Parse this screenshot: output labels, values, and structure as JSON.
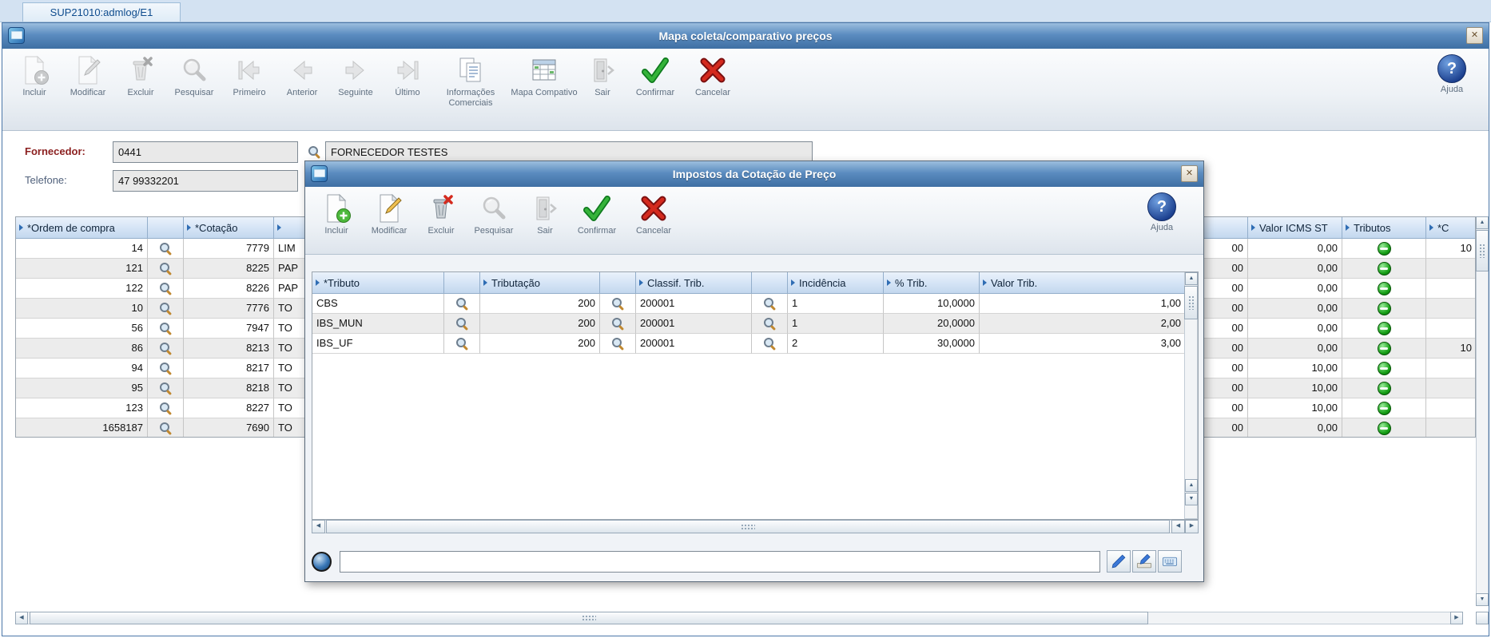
{
  "app": {
    "tab_title": "SUP21010:admlog/E1"
  },
  "colors": {
    "titlebar_blue": "#4f7fb3",
    "header_blue": "#c3d8ee",
    "confirm_green": "#35b33a",
    "cancel_red": "#d42a1e",
    "tributos_green": "#17a017",
    "label_maroon": "#8b1f1f"
  },
  "main_window": {
    "title": "Mapa coleta/comparativo preços",
    "toolbar": [
      {
        "label": "Incluir",
        "disabled": true
      },
      {
        "label": "Modificar",
        "disabled": true
      },
      {
        "label": "Excluir",
        "disabled": true
      },
      {
        "label": "Pesquisar",
        "disabled": true
      },
      {
        "label": "Primeiro",
        "disabled": true
      },
      {
        "label": "Anterior",
        "disabled": true
      },
      {
        "label": "Seguinte",
        "disabled": true
      },
      {
        "label": "Último",
        "disabled": true
      },
      {
        "label": "Informações Comerciais",
        "disabled": false
      },
      {
        "label": "Mapa Compativo",
        "disabled": false
      },
      {
        "label": "Sair",
        "disabled": true
      },
      {
        "label": "Confirmar",
        "disabled": false
      },
      {
        "label": "Cancelar",
        "disabled": false
      }
    ],
    "help_label": "Ajuda",
    "form": {
      "fornecedor_label": "Fornecedor:",
      "fornecedor_code": "0441",
      "fornecedor_name": "FORNECEDOR TESTES",
      "telefone_label": "Telefone:",
      "telefone_value": "47 99332201"
    },
    "table": {
      "col_ordem": "*Ordem de compra",
      "col_cotacao": "*Cotação",
      "col_icms_st": "Valor ICMS ST",
      "col_tributos": "Tributos",
      "col_partial": "*C",
      "rows": [
        {
          "ordem": "14",
          "cotacao": "7779",
          "desc": "LIM",
          "tail": "00",
          "icms_st": "0,00",
          "partial": "10"
        },
        {
          "ordem": "121",
          "cotacao": "8225",
          "desc": "PAP",
          "tail": "00",
          "icms_st": "0,00",
          "partial": ""
        },
        {
          "ordem": "122",
          "cotacao": "8226",
          "desc": "PAP",
          "tail": "00",
          "icms_st": "0,00",
          "partial": ""
        },
        {
          "ordem": "10",
          "cotacao": "7776",
          "desc": "TO",
          "tail": "00",
          "icms_st": "0,00",
          "partial": ""
        },
        {
          "ordem": "56",
          "cotacao": "7947",
          "desc": "TO",
          "tail": "00",
          "icms_st": "0,00",
          "partial": ""
        },
        {
          "ordem": "86",
          "cotacao": "8213",
          "desc": "TO",
          "tail": "00",
          "icms_st": "0,00",
          "partial": "10"
        },
        {
          "ordem": "94",
          "cotacao": "8217",
          "desc": "TO",
          "tail": "00",
          "icms_st": "10,00",
          "partial": ""
        },
        {
          "ordem": "95",
          "cotacao": "8218",
          "desc": "TO",
          "tail": "00",
          "icms_st": "10,00",
          "partial": ""
        },
        {
          "ordem": "123",
          "cotacao": "8227",
          "desc": "TO",
          "tail": "00",
          "icms_st": "10,00",
          "partial": ""
        },
        {
          "ordem": "1658187",
          "cotacao": "7690",
          "desc": "TO",
          "tail": "00",
          "icms_st": "0,00",
          "partial": ""
        }
      ]
    }
  },
  "modal": {
    "title": "Impostos da Cotação de Preço",
    "toolbar": [
      {
        "label": "Incluir",
        "disabled": false
      },
      {
        "label": "Modificar",
        "disabled": false
      },
      {
        "label": "Excluir",
        "disabled": false
      },
      {
        "label": "Pesquisar",
        "disabled": true
      },
      {
        "label": "Sair",
        "disabled": true
      },
      {
        "label": "Confirmar",
        "disabled": false
      },
      {
        "label": "Cancelar",
        "disabled": false
      }
    ],
    "help_label": "Ajuda",
    "table": {
      "col_tributo": "*Tributo",
      "col_tributacao": "Tributação",
      "col_classif": "Classif. Trib.",
      "col_incidencia": "Incidência",
      "col_perc": "% Trib.",
      "col_valor": "Valor Trib.",
      "rows": [
        {
          "tributo": "CBS",
          "tributacao": "200",
          "classif": "200001",
          "incidencia": "1",
          "perc": "10,0000",
          "valor": "1,00"
        },
        {
          "tributo": "IBS_MUN",
          "tributacao": "200",
          "classif": "200001",
          "incidencia": "1",
          "perc": "20,0000",
          "valor": "2,00"
        },
        {
          "tributo": "IBS_UF",
          "tributacao": "200",
          "classif": "200001",
          "incidencia": "2",
          "perc": "30,0000",
          "valor": "3,00"
        }
      ]
    },
    "statusbar": {
      "input_value": ""
    }
  }
}
